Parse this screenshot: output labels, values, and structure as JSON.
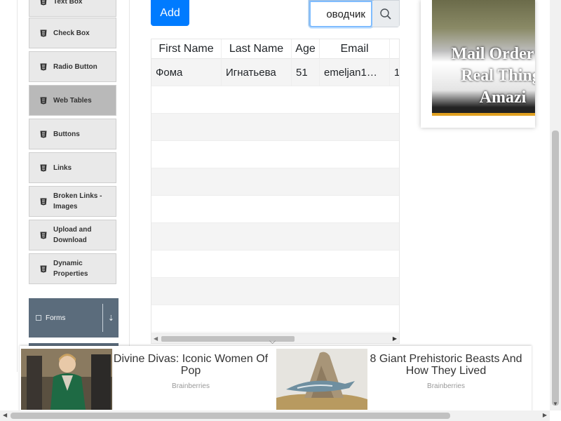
{
  "sidebar": {
    "items": [
      {
        "label": "Text Box"
      },
      {
        "label": "Check Box"
      },
      {
        "label": "Radio Button"
      },
      {
        "label": "Web Tables",
        "active": true
      },
      {
        "label": "Buttons"
      },
      {
        "label": "Links"
      },
      {
        "label": "Broken Links - Images"
      },
      {
        "label": "Upload and Download"
      },
      {
        "label": "Dynamic Properties"
      }
    ],
    "forms_group": "Forms"
  },
  "toolbar": {
    "add_label": "Add",
    "search_value": "оводчик"
  },
  "table": {
    "headers": [
      "First Name",
      "Last Name",
      "Age",
      "Email",
      ""
    ],
    "rows": [
      [
        "Фома",
        "Игнатьева",
        "51",
        "emeljan1…",
        "1"
      ]
    ]
  },
  "ad_right": {
    "lines": [
      "Mail Order W",
      "Real Thing,",
      "Amazi"
    ]
  },
  "bottom_ads": [
    {
      "title": "Divine Divas: Iconic Women Of Pop",
      "source": "Brainberries"
    },
    {
      "title": "8 Giant Prehistoric Beasts And How They Lived",
      "source": "Brainberries"
    }
  ],
  "colors": {
    "accent": "#007bff",
    "menu_bg": "#e9e9e9",
    "menu_active": "#b9b9b9",
    "group_bg": "#5b6c7c"
  }
}
